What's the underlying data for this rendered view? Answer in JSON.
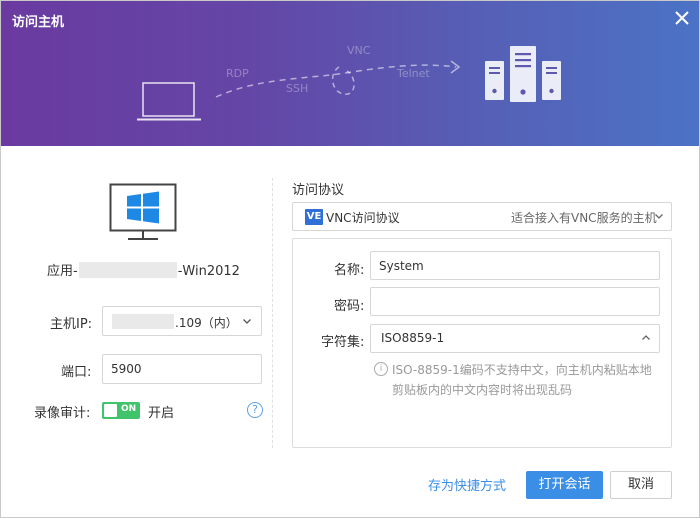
{
  "window": {
    "title": "访问主机",
    "close_icon": "close-icon"
  },
  "banner": {
    "protocols": [
      "RDP",
      "SSH",
      "VNC",
      "Telnet"
    ],
    "icons": [
      "laptop-icon",
      "server-icon"
    ]
  },
  "host": {
    "icon": "windows-monitor-icon",
    "name_prefix": "应用-",
    "name_suffix": "-Win2012",
    "ip_label": "主机IP:",
    "ip_value": ".109（内）",
    "port_label": "端口:",
    "port_value": "5900",
    "record_label": "录像审计:",
    "record_toggle_text": "ON",
    "record_state": "开启",
    "help_icon_text": "?"
  },
  "protocol": {
    "section_title": "访问协议",
    "badge": "VE",
    "selected": "VNC访问协议",
    "hint": "适合接入有VNC服务的主机"
  },
  "form": {
    "name_label": "名称:",
    "name_value": "System",
    "password_label": "密码:",
    "password_value": "",
    "charset_label": "字符集:",
    "charset_value": "ISO8859-1",
    "info_icon_text": "i",
    "info_text": "ISO-8859-1编码不支持中文，向主机内粘贴本地剪贴板内的中文内容时将出现乱码"
  },
  "footer": {
    "shortcut_label": "存为快捷方式",
    "open_label": "打开会话",
    "cancel_label": "取消"
  },
  "colors": {
    "banner_start": "#6a3aa0",
    "banner_end": "#4b73c6",
    "accent": "#3a8ee6",
    "toggle_on": "#3fc36b",
    "windows_blue": "#1e88e5"
  }
}
